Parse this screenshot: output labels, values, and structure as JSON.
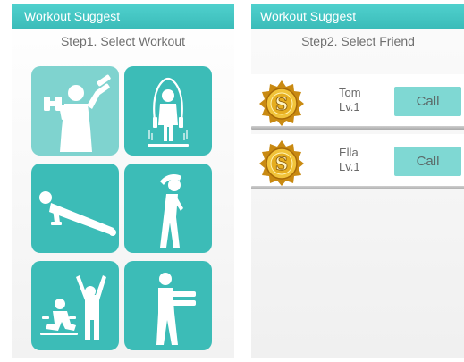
{
  "left": {
    "title": "Workout Suggest",
    "step": "Step1. Select Workout",
    "workouts": [
      {
        "name": "dumbbell",
        "selected": true
      },
      {
        "name": "jump-rope",
        "selected": false
      },
      {
        "name": "push-up",
        "selected": false
      },
      {
        "name": "side-stretch",
        "selected": false
      },
      {
        "name": "squat-jump",
        "selected": false
      },
      {
        "name": "arm-raise",
        "selected": false
      }
    ]
  },
  "right": {
    "title": "Workout Suggest",
    "step": "Step2. Select Friend",
    "friends": [
      {
        "name": "Tom",
        "level": "Lv.1",
        "button": "Call",
        "avatar_icon": "gold-coin-s-icon"
      },
      {
        "name": "Ella",
        "level": "Lv.1",
        "button": "Call",
        "avatar_icon": "gold-coin-s-icon"
      }
    ]
  },
  "colors": {
    "titlebar": "#45c6c3",
    "tile": "#3cbcb7",
    "tile_selected": "#7fd3cf",
    "call_button": "#7fd8d3",
    "coin_gold": "#e0a81e"
  }
}
